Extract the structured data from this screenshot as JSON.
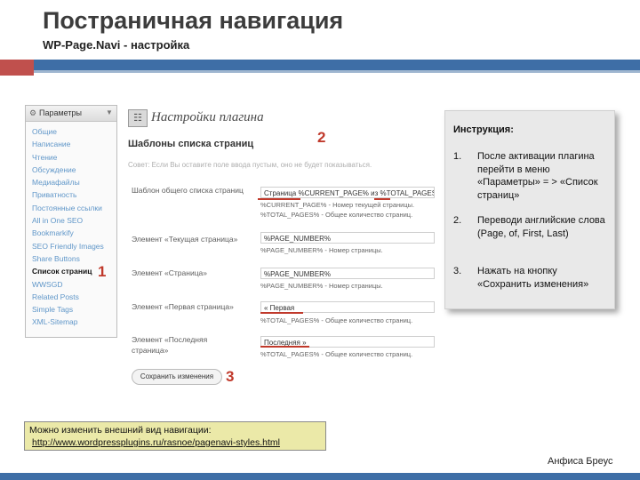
{
  "slide": {
    "title": "Постраничная навигация",
    "subtitle": "WP-Page.Navi - настройка",
    "author": "Анфиса Бреус",
    "accent_color": "#3e6ea6",
    "marker_color": "#c0392b"
  },
  "sidebar": {
    "header": "Параметры",
    "items": [
      {
        "label": "Общие"
      },
      {
        "label": "Написание"
      },
      {
        "label": "Чтение"
      },
      {
        "label": "Обсуждение"
      },
      {
        "label": "Медиафайлы"
      },
      {
        "label": "Приватность"
      },
      {
        "label": "Постоянные ссылки"
      },
      {
        "label": "All in One SEO"
      },
      {
        "label": "Bookmarkify"
      },
      {
        "label": "SEO Friendly Images"
      },
      {
        "label": "Share Buttons"
      },
      {
        "label": "Список страниц"
      },
      {
        "label": "WWSGD"
      },
      {
        "label": "Related Posts"
      },
      {
        "label": "Simple Tags"
      },
      {
        "label": "XML-Sitemap"
      }
    ]
  },
  "main": {
    "page_title": "Настройки плагина",
    "section_title": "Шаблоны списка страниц",
    "section_desc": "Совет: Если Вы оставите поле ввода пустым, оно не будет показываться.",
    "rows": [
      {
        "label": "Шаблон общего списка страниц",
        "value": "Страница %CURRENT_PAGE% из %TOTAL_PAGES%",
        "hint1": "%CURRENT_PAGE% - Номер текущей страницы.",
        "hint2": "%TOTAL_PAGES% - Общее количество страниц."
      },
      {
        "label": "Элемент «Текущая страница»",
        "value": "%PAGE_NUMBER%",
        "hint1": "%PAGE_NUMBER% - Номер страницы.",
        "hint2": ""
      },
      {
        "label": "Элемент «Страница»",
        "value": "%PAGE_NUMBER%",
        "hint1": "%PAGE_NUMBER% - Номер страницы.",
        "hint2": ""
      },
      {
        "label": "Элемент «Первая страница»",
        "value": "« Первая",
        "hint1": "%TOTAL_PAGES% - Общее количество страниц.",
        "hint2": ""
      },
      {
        "label": "Элемент «Последняя страница»",
        "value": "Последняя »",
        "hint1": "%TOTAL_PAGES% - Общее количество страниц.",
        "hint2": ""
      }
    ],
    "save_label": "Сохранить изменения"
  },
  "markers": {
    "m1": "1",
    "m2": "2",
    "m3": "3"
  },
  "instructions": {
    "title": "Инструкция:",
    "steps": [
      {
        "n": "1.",
        "text": "После активации плагина перейти в меню «Параметры» = > «Список страниц»"
      },
      {
        "n": "2.",
        "text": "Переводи английские слова (Page, of, First, Last)"
      },
      {
        "n": "3.",
        "text": "Нажать на кнопку «Сохранить изменения»"
      }
    ]
  },
  "note": {
    "line1": "Можно изменить внешний вид навигации:",
    "link": "http://www.wordpressplugins.ru/rasnoe/pagenavi-styles.html"
  }
}
